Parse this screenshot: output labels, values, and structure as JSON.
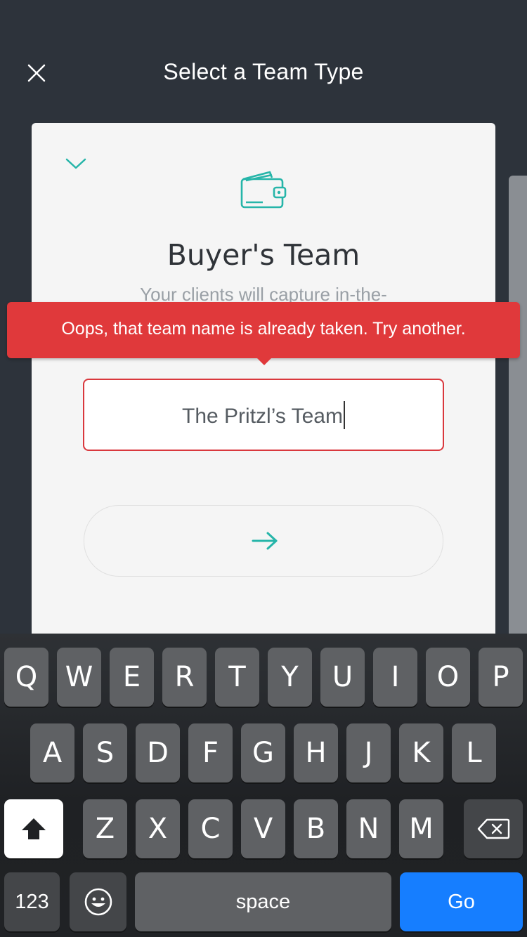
{
  "header": {
    "title": "Select a Team Type",
    "close_icon": "close-icon"
  },
  "card": {
    "heading": "Buyer's Team",
    "description": "Your clients will capture in-the-moment feedback as they tour a home.",
    "icon": "wallet-icon",
    "accent_color": "#26b5a9"
  },
  "error": {
    "message": "Oops, that team name is already taken. Try another.",
    "color": "#e0393b"
  },
  "team_name_input": {
    "value": "The Pritzl’s Team"
  },
  "next_button": {
    "icon": "arrow-right-icon"
  },
  "keyboard": {
    "row1": [
      "Q",
      "W",
      "E",
      "R",
      "T",
      "Y",
      "U",
      "I",
      "O",
      "P"
    ],
    "row2": [
      "A",
      "S",
      "D",
      "F",
      "G",
      "H",
      "J",
      "K",
      "L"
    ],
    "row3": [
      "Z",
      "X",
      "C",
      "V",
      "B",
      "N",
      "M"
    ],
    "numbers_label": "123",
    "space_label": "space",
    "go_label": "Go",
    "go_color": "#167eff"
  }
}
